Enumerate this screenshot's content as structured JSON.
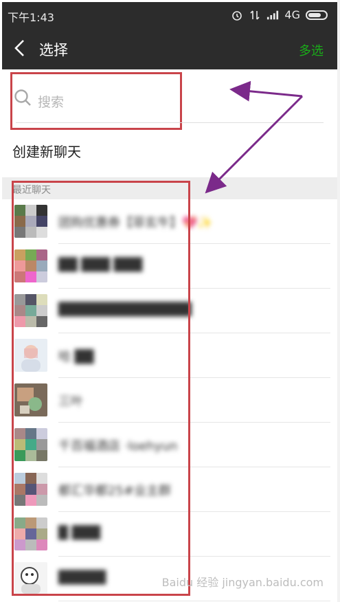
{
  "status_bar": {
    "time": "下午1:43",
    "network": "4G"
  },
  "header": {
    "title": "选择",
    "multi_select": "多选"
  },
  "search": {
    "placeholder": "搜索"
  },
  "new_chat": {
    "label": "创建新聊天"
  },
  "section": {
    "title": "最近聊天"
  },
  "chats": [
    {
      "name": "团购优惠券【菲玄牛】💖✨"
    },
    {
      "name": "██ ███ ███"
    },
    {
      "name": "██████████████"
    },
    {
      "name": "哈 ██"
    },
    {
      "name": "三叶"
    },
    {
      "name": "千百福酒店 ·loehyun"
    },
    {
      "name": "都汇华都25#业主群"
    },
    {
      "name": "█ ███"
    },
    {
      "name": "█████"
    }
  ],
  "watermark": {
    "text": "Baidu 经验 jingyan.baidu.com"
  },
  "colors": {
    "accent": "#1aad19",
    "bar": "#2c2c2c",
    "highlight": "#c9444a",
    "arrow": "#7b2a8a"
  }
}
